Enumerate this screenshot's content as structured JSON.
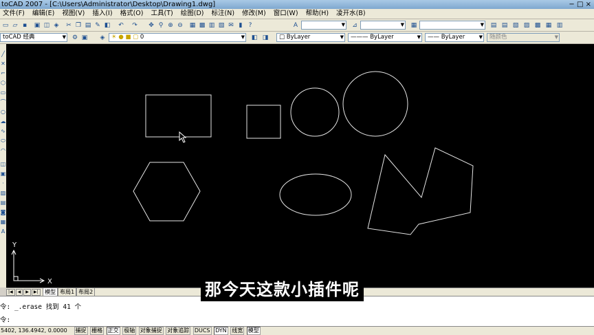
{
  "window": {
    "title": "toCAD 2007 - [C:\\Users\\Administrator\\Desktop\\Drawing1.dwg]",
    "controls": [
      "−",
      "□",
      "×"
    ]
  },
  "menu": [
    "文件(F)",
    "编辑(E)",
    "视图(V)",
    "插入(I)",
    "格式(O)",
    "工具(T)",
    "绘图(D)",
    "标注(N)",
    "修改(M)",
    "窗口(W)",
    "帮助(H)",
    "凌开水(B)"
  ],
  "toolbar2": {
    "workspace": "toCAD 经典",
    "layer": "0",
    "color": "ByLayer",
    "linetype": "ByLayer",
    "lineweight": "ByLayer",
    "plotstyle": "随颜色"
  },
  "canvas": {
    "background": "#000000",
    "ucs": {
      "y_label": "Y",
      "x_label": "X"
    }
  },
  "tabs": {
    "nav": [
      "|◀",
      "◀",
      "▶",
      "▶|"
    ],
    "items": [
      "模型",
      "布局1",
      "布局2"
    ],
    "active_index": 0
  },
  "command": {
    "line1": "令: _.erase 找到 41 个",
    "line2": "令:"
  },
  "status": {
    "coords": "5402, 136.4942, 0.0000",
    "buttons": [
      {
        "label": "捕捉",
        "on": false
      },
      {
        "label": "栅格",
        "on": false
      },
      {
        "label": "正交",
        "on": true
      },
      {
        "label": "极轴",
        "on": false
      },
      {
        "label": "对象捕捉",
        "on": false
      },
      {
        "label": "对象追踪",
        "on": false
      },
      {
        "label": "DUCS",
        "on": false
      },
      {
        "label": "DYN",
        "on": true
      },
      {
        "label": "线宽",
        "on": false
      },
      {
        "label": "模型",
        "on": true
      }
    ]
  },
  "subtitle": "那今天这款小插件呢"
}
